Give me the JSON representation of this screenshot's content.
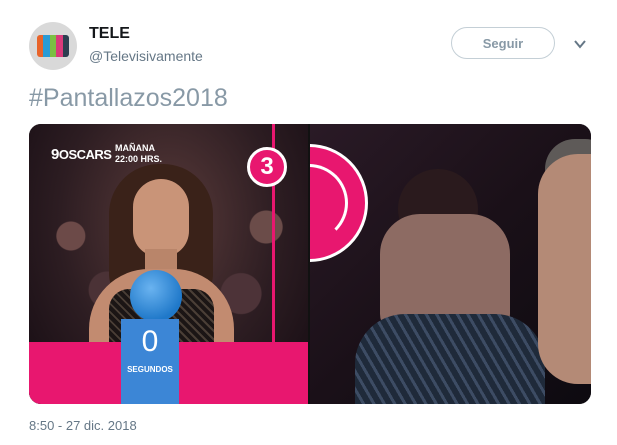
{
  "account": {
    "name": "TELE",
    "handle": "@Televisivamente",
    "avatar_colors": [
      "#e8642a",
      "#2a9bd6",
      "#7bc043",
      "#d83a7a",
      "#2c3e50"
    ]
  },
  "follow_label": "Seguir",
  "menu_icon": "chevron-down-icon",
  "tweet_text": "#Pantallazos2018",
  "media": {
    "logo_prefix": "9",
    "logo_text": "OSCARS",
    "promo_line1": "MAÑANA",
    "promo_line2": "22:00 HRS.",
    "badge_number": "3",
    "counter_value": "0",
    "counter_label": "SEGUNDOS",
    "accent_color": "#e8176f"
  },
  "timestamp": "8:50 - 27 dic. 2018"
}
